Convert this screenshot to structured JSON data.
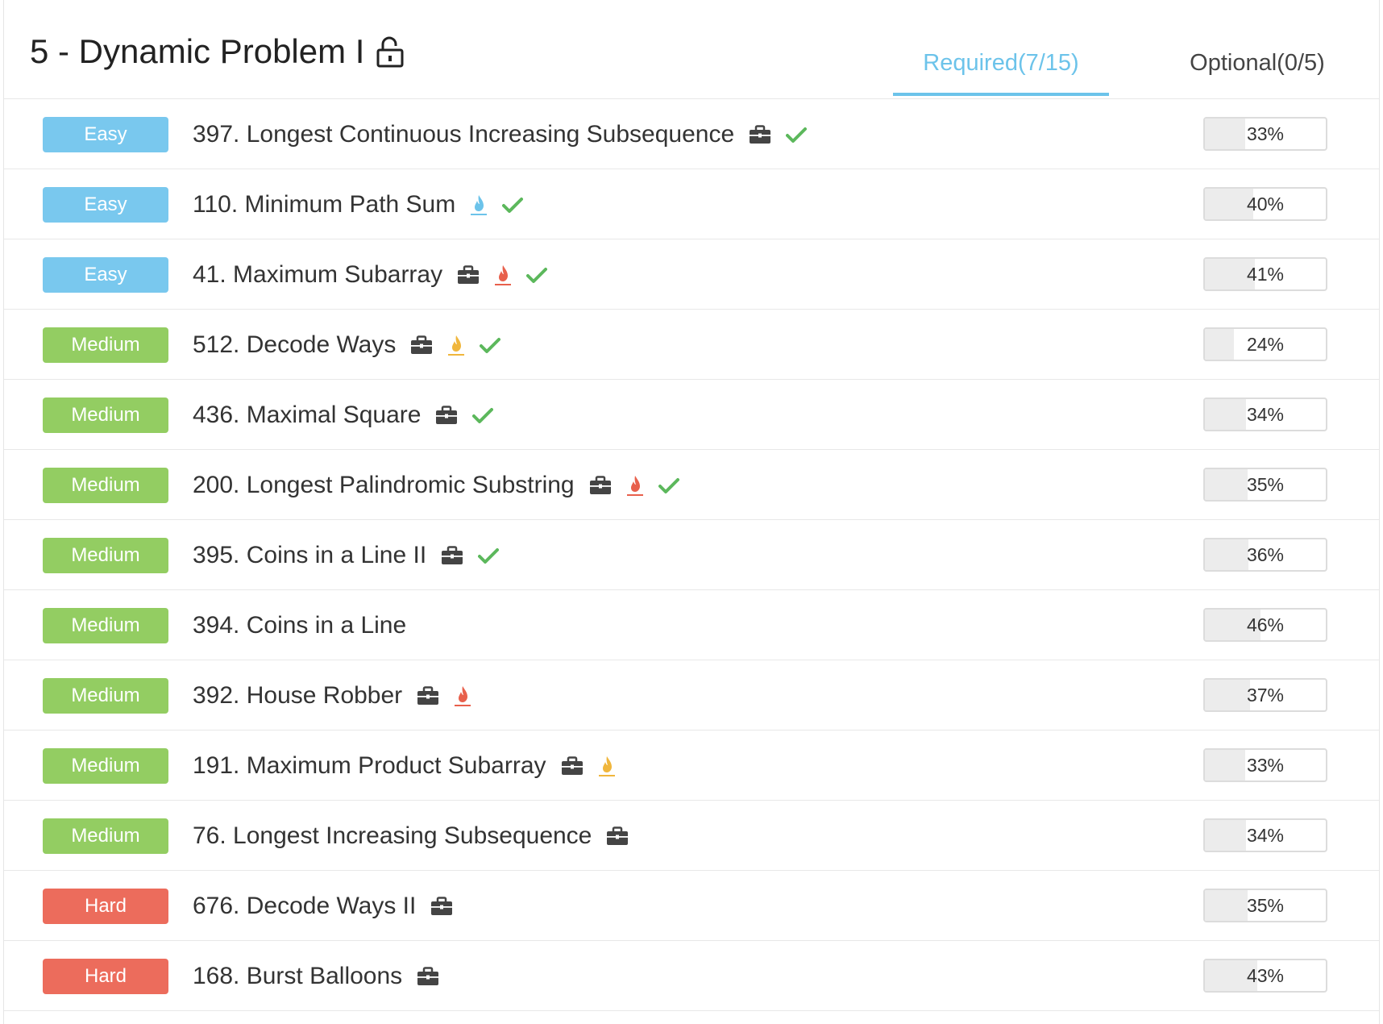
{
  "section": {
    "title": "5 - Dynamic Problem I",
    "lock_icon": "unlock-icon"
  },
  "tabs": {
    "required": "Required(7/15)",
    "optional": "Optional(0/5)",
    "active": "required"
  },
  "colors": {
    "accent": "#6cc3ea",
    "easy": "#79c8ee",
    "medium": "#93cd62",
    "hard": "#ec6c5c",
    "check": "#5cb85c",
    "briefcase": "#444444",
    "flame_blue": "#6cc3ea",
    "flame_red": "#e8604c",
    "flame_orange": "#f0b63c"
  },
  "problems": [
    {
      "difficulty": "Easy",
      "title": "397. Longest Continuous Increasing Subsequence",
      "icons": [
        "briefcase-icon"
      ],
      "solved": true,
      "rate": "33%",
      "rate_value": 0.33
    },
    {
      "difficulty": "Easy",
      "title": "110. Minimum Path Sum",
      "icons": [
        "flame-blue-icon"
      ],
      "solved": true,
      "rate": "40%",
      "rate_value": 0.4
    },
    {
      "difficulty": "Easy",
      "title": "41. Maximum Subarray",
      "icons": [
        "briefcase-icon",
        "flame-red-icon"
      ],
      "solved": true,
      "rate": "41%",
      "rate_value": 0.41
    },
    {
      "difficulty": "Medium",
      "title": "512. Decode Ways",
      "icons": [
        "briefcase-icon",
        "flame-orange-icon"
      ],
      "solved": true,
      "rate": "24%",
      "rate_value": 0.24
    },
    {
      "difficulty": "Medium",
      "title": "436. Maximal Square",
      "icons": [
        "briefcase-icon"
      ],
      "solved": true,
      "rate": "34%",
      "rate_value": 0.34
    },
    {
      "difficulty": "Medium",
      "title": "200. Longest Palindromic Substring",
      "icons": [
        "briefcase-icon",
        "flame-red-icon"
      ],
      "solved": true,
      "rate": "35%",
      "rate_value": 0.35
    },
    {
      "difficulty": "Medium",
      "title": "395. Coins in a Line II",
      "icons": [
        "briefcase-icon"
      ],
      "solved": true,
      "rate": "36%",
      "rate_value": 0.36
    },
    {
      "difficulty": "Medium",
      "title": "394. Coins in a Line",
      "icons": [],
      "solved": false,
      "rate": "46%",
      "rate_value": 0.46
    },
    {
      "difficulty": "Medium",
      "title": "392. House Robber",
      "icons": [
        "briefcase-icon",
        "flame-red-icon"
      ],
      "solved": false,
      "rate": "37%",
      "rate_value": 0.37
    },
    {
      "difficulty": "Medium",
      "title": "191. Maximum Product Subarray",
      "icons": [
        "briefcase-icon",
        "flame-orange-icon"
      ],
      "solved": false,
      "rate": "33%",
      "rate_value": 0.33
    },
    {
      "difficulty": "Medium",
      "title": "76. Longest Increasing Subsequence",
      "icons": [
        "briefcase-icon"
      ],
      "solved": false,
      "rate": "34%",
      "rate_value": 0.34
    },
    {
      "difficulty": "Hard",
      "title": "676. Decode Ways II",
      "icons": [
        "briefcase-icon"
      ],
      "solved": false,
      "rate": "35%",
      "rate_value": 0.35
    },
    {
      "difficulty": "Hard",
      "title": "168. Burst Balloons",
      "icons": [
        "briefcase-icon"
      ],
      "solved": false,
      "rate": "43%",
      "rate_value": 0.43
    }
  ]
}
